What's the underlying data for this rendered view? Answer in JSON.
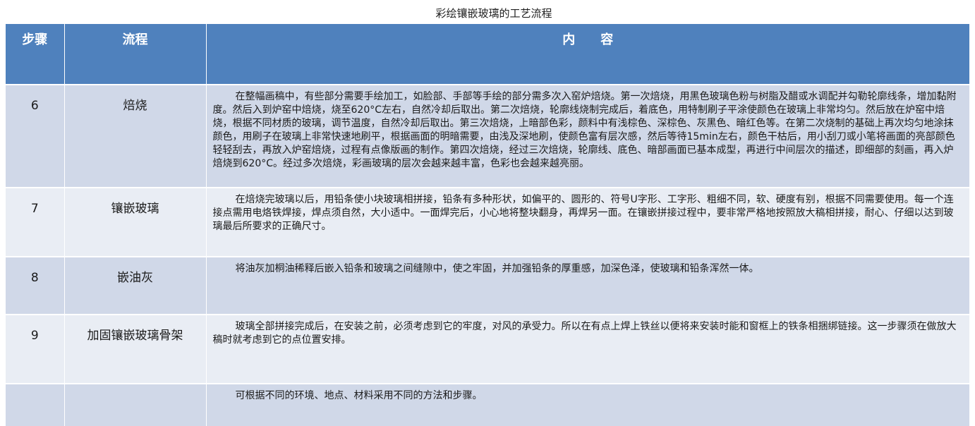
{
  "title": "彩绘镶嵌玻璃的工艺流程",
  "headers": {
    "step": "步骤",
    "process": "流程",
    "content": "内　　容"
  },
  "rows": [
    {
      "step": "6",
      "process": "焙烧",
      "content": "在整幅画稿中，有些部分需要手绘加工，如脸部、手部等手绘的部分需多次入窑炉焙烧。第一次焙烧，用黑色玻璃色粉与树脂及醋或水调配并勾勒轮廓线条，增加黏附度。然后入到炉窑中焙烧，烧至620°C左右，自然冷却后取出。第二次焙烧，轮廓线烧制完成后，着底色，用特制刷子平涂使颜色在玻璃上非常均匀。然后放在炉窑中焙烧，根据不同材质的玻璃，调节温度，自然冷却后取出。第三次焙烧，上暗部色彩，颜料中有浅棕色、深棕色、灰黑色、暗红色等。在第二次烧制的基础上再次均匀地涂抹颜色，用刷子在玻璃上非常快速地刷平，根据画面的明暗需要，由浅及深地刷，使颜色富有层次感，然后等待15min左右，颜色干枯后，用小刮刀或小笔将画面的亮部颜色轻轻刮去，再放入炉窑焙烧，过程有点像版画的制作。第四次焙烧，经过三次焙烧，轮廓线、底色、暗部画面已基本成型，再进行中间层次的描述，即细部的刻画，再入炉焙烧到620°C。经过多次焙烧，彩画玻璃的层次会越来越丰富，色彩也会越来越亮丽。"
    },
    {
      "step": "7",
      "process": "镶嵌玻璃",
      "content": "在焙烧完玻璃以后，用铅条使小块玻璃相拼接，铅条有多种形状，如偏平的、圆形的、符号U字形、工字形、粗细不同，软、硬度有别，根据不同需要使用。每一个连接点需用电烙铁焊接，焊点须自然，大小适中。一面焊完后，小心地将整块翻身，再焊另一面。在镶嵌拼接过程中，要非常严格地按照放大稿相拼接，耐心、仔细以达到玻璃最后所要求的正确尺寸。"
    },
    {
      "step": "8",
      "process": "嵌油灰",
      "content": "将油灰加桐油稀释后嵌入铅条和玻璃之间缝隙中，使之牢固，并加强铅条的厚重感，加深色泽，使玻璃和铅条浑然一体。"
    },
    {
      "step": "9",
      "process": "加固镶嵌玻璃骨架",
      "content": "玻璃全部拼接完成后，在安装之前，必须考虑到它的牢度，对风的承受力。所以在有点上焊上铁丝以便将来安装时能和窗框上的铁条相捆绑链接。这一步骤须在做放大稿时就考虑到它的点位置安排。"
    },
    {
      "step": "",
      "process": "",
      "content": "可根据不同的环境、地点、材料采用不同的方法和步骤。"
    }
  ],
  "colors": {
    "header_bg": "#4f81bd",
    "row_dark": "#d0d8e8",
    "row_light": "#e9edf4"
  }
}
